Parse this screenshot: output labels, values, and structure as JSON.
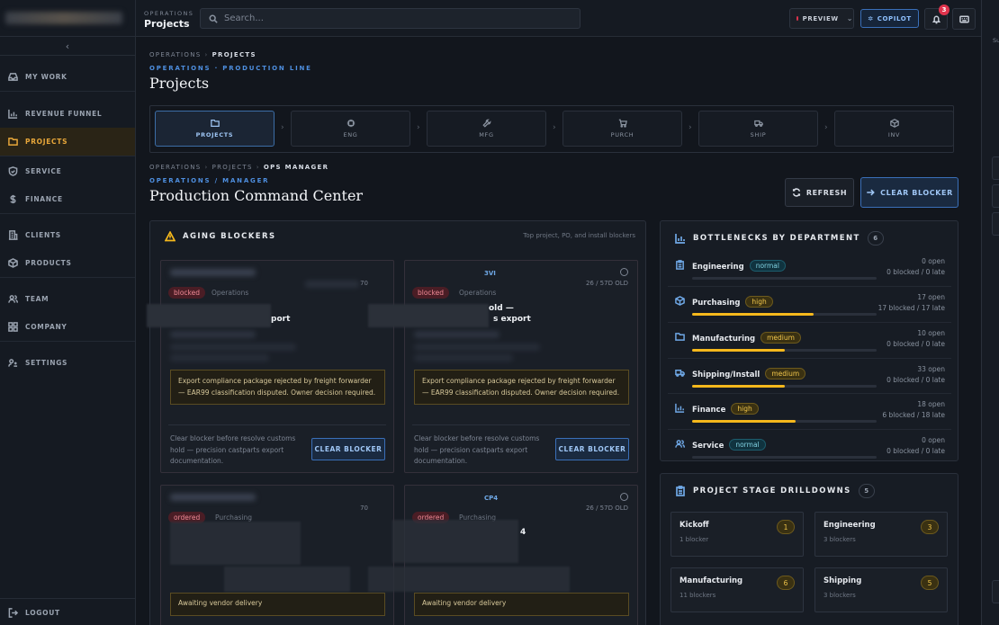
{
  "sidebar": {
    "items": [
      {
        "label": "MY WORK",
        "icon": "inbox-icon"
      },
      {
        "label": "REVENUE FUNNEL",
        "icon": "bar-chart-icon"
      },
      {
        "label": "PROJECTS",
        "icon": "folder-icon",
        "active": true
      },
      {
        "label": "SERVICE",
        "icon": "shield-icon"
      },
      {
        "label": "FINANCE",
        "icon": "dollar-icon"
      },
      {
        "label": "CLIENTS",
        "icon": "building-icon"
      },
      {
        "label": "PRODUCTS",
        "icon": "box-icon"
      },
      {
        "label": "TEAM",
        "icon": "users-icon"
      },
      {
        "label": "COMPANY",
        "icon": "grid-icon"
      },
      {
        "label": "SETTINGS",
        "icon": "settings-icon"
      }
    ],
    "logout": "LOGOUT",
    "collapse": "‹"
  },
  "topbar": {
    "kicker": "OPERATIONS",
    "title": "Projects",
    "search_placeholder": "Search...",
    "preview_label": "PREVIEW",
    "copilot_label": "COPILOT",
    "notifications_count": "3"
  },
  "right_panel": {
    "label": "Su"
  },
  "page": {
    "breadcrumb": [
      "OPERATIONS",
      "PROJECTS"
    ],
    "kicker": "OPERATIONS · PRODUCTION LINE",
    "title": "Projects"
  },
  "stages": [
    {
      "label": "PROJECTS",
      "active": true
    },
    {
      "label": "ENG"
    },
    {
      "label": "MFG"
    },
    {
      "label": "PURCH"
    },
    {
      "label": "SHIP"
    },
    {
      "label": "INV"
    }
  ],
  "subpage": {
    "breadcrumb": [
      "OPERATIONS",
      "PROJECTS",
      "OPS MANAGER"
    ],
    "kicker": "OPERATIONS / MANAGER",
    "title": "Production Command Center",
    "refresh_label": "REFRESH",
    "clear_label": "CLEAR BLOCKER"
  },
  "aging": {
    "title": "AGING BLOCKERS",
    "subtitle": "Top project, PO, and install blockers",
    "cards": [
      {
        "code": "",
        "age": "70",
        "status": "blocked",
        "dept": "Operations",
        "title_fragment": "port",
        "issue": "Export compliance package rejected by freight forwarder — EAR99 classification disputed. Owner decision required.",
        "note": "Clear blocker before resolve customs hold — precision castparts export documentation.",
        "button": "CLEAR BLOCKER"
      },
      {
        "code": "3VI",
        "age": "26 / 57D OLD",
        "status": "blocked",
        "dept": "Operations",
        "title_fragment": "old —",
        "title_fragment2": "s export",
        "issue": "Export compliance package rejected by freight forwarder — EAR99 classification disputed. Owner decision required.",
        "note": "Clear blocker before resolve customs hold — precision castparts export documentation.",
        "button": "CLEAR BLOCKER"
      },
      {
        "code": "",
        "age": "70",
        "status": "ordered",
        "dept": "Purchasing",
        "note": "Awaiting vendor delivery"
      },
      {
        "code": "CP4",
        "age": "26 / 57D OLD",
        "status": "ordered",
        "dept": "Purchasing",
        "title_fragment": "4",
        "note": "Awaiting vendor delivery"
      }
    ]
  },
  "bottlenecks": {
    "title": "BOTTLENECKS BY DEPARTMENT",
    "count": "6",
    "rows": [
      {
        "name": "Engineering",
        "severity": "normal",
        "open": "0 open",
        "detail": "0 blocked / 0 late",
        "fill": 0
      },
      {
        "name": "Purchasing",
        "severity": "high",
        "open": "17 open",
        "detail": "17 blocked / 17 late",
        "fill": 0.66
      },
      {
        "name": "Manufacturing",
        "severity": "medium",
        "open": "10 open",
        "detail": "0 blocked / 0 late",
        "fill": 0.5
      },
      {
        "name": "Shipping/Install",
        "severity": "medium",
        "open": "33 open",
        "detail": "0 blocked / 0 late",
        "fill": 0.5
      },
      {
        "name": "Finance",
        "severity": "high",
        "open": "18 open",
        "detail": "6 blocked / 18 late",
        "fill": 0.56
      },
      {
        "name": "Service",
        "severity": "normal",
        "open": "0 open",
        "detail": "0 blocked / 0 late",
        "fill": 0
      }
    ]
  },
  "drilldowns": {
    "title": "PROJECT STAGE DRILLDOWNS",
    "count": "5",
    "items": [
      {
        "name": "Kickoff",
        "count": "1",
        "sub": "1 blocker"
      },
      {
        "name": "Engineering",
        "count": "3",
        "sub": "3 blockers"
      },
      {
        "name": "Manufacturing",
        "count": "6",
        "sub": "11 blockers"
      },
      {
        "name": "Shipping",
        "count": "5",
        "sub": "3 blockers"
      }
    ]
  },
  "colors": {
    "accent": "#e8a73a",
    "primary": "#4e8fe0",
    "danger": "#e0344d",
    "warning": "#f5b81c"
  }
}
